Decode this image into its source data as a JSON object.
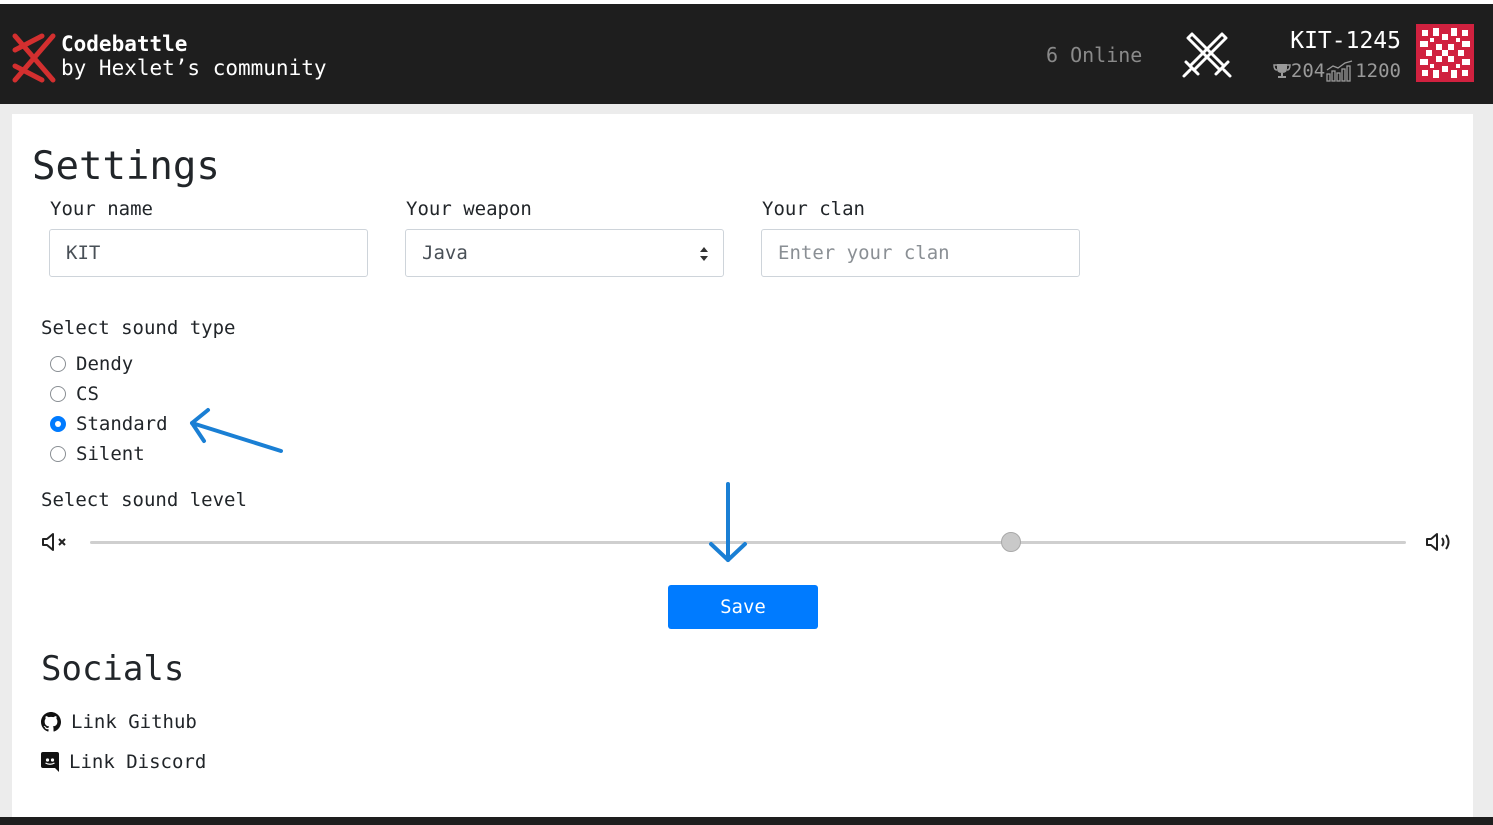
{
  "brand": {
    "title": "Codebattle",
    "subtitle": "by Hexlet’s community"
  },
  "header": {
    "online_text": "6 Online",
    "user_name": "KIT-1245",
    "rank": "204",
    "rating": "1200"
  },
  "settings": {
    "title": "Settings",
    "name_label": "Your name",
    "name_value": "KIT",
    "weapon_label": "Your weapon",
    "weapon_value": "Java",
    "clan_label": "Your clan",
    "clan_placeholder": "Enter your clan",
    "sound_type_label": "Select sound type",
    "sound_options": [
      {
        "label": "Dendy",
        "checked": false
      },
      {
        "label": "CS",
        "checked": false
      },
      {
        "label": "Standard",
        "checked": true
      },
      {
        "label": "Silent",
        "checked": false
      }
    ],
    "sound_level_label": "Select sound level",
    "sound_level": 0.7,
    "save_label": "Save"
  },
  "socials": {
    "title": "Socials",
    "github_label": "Link Github",
    "discord_label": "Link Discord"
  },
  "colors": {
    "accent": "#007bff",
    "navbar": "#1e1e1e",
    "logo": "#d32f2f",
    "annotation": "#1a7fd4"
  },
  "icons": [
    "codebattle-logo-icon",
    "crossed-swords-icon",
    "trophy-icon",
    "rating-chart-icon",
    "avatar-identicon",
    "mute-icon",
    "volume-icon",
    "github-icon",
    "discord-icon",
    "select-caret-icon"
  ]
}
